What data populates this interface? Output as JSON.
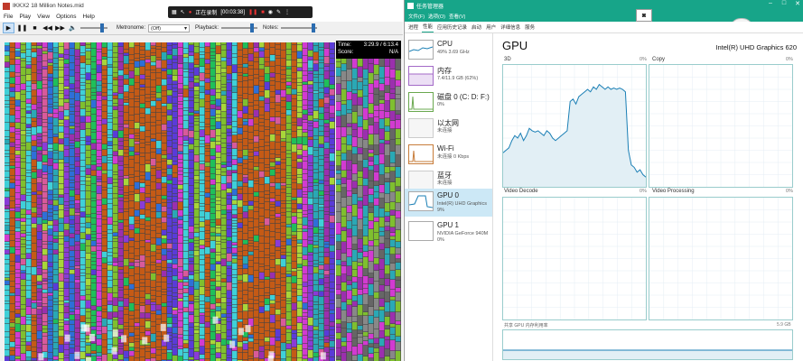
{
  "left_window": {
    "title": "IKKX2 18 Million Notes.mid",
    "menu": [
      "File",
      "Play",
      "View",
      "Options",
      "Help"
    ],
    "toolbar": {
      "metronome_label": "Metronome:",
      "metronome_value": "(Off)",
      "playback_label": "Playback:",
      "notes_label": "Notes:"
    },
    "recording_bar": {
      "status": "正在录制",
      "time": "[00:03:38]"
    },
    "info": {
      "time_label": "Time:",
      "time_value": "3:29.9 / 6:13.4",
      "score_label": "Score:",
      "score_value": "N/A"
    }
  },
  "task_manager": {
    "title": "任务管理器",
    "menu": [
      "文件(F)",
      "选项(O)",
      "查看(V)"
    ],
    "tabs": [
      "进程",
      "性能",
      "应用历史记录",
      "启动",
      "用户",
      "详细信息",
      "服务"
    ],
    "active_tab": "性能",
    "resources": [
      {
        "name": "CPU",
        "sub": "49% 3.69 GHz"
      },
      {
        "name": "内存",
        "sub": "7.4/11.9 GB (62%)"
      },
      {
        "name": "磁盘 0 (C: D: F:)",
        "sub": "0%"
      },
      {
        "name": "以太网",
        "sub": "未连接"
      },
      {
        "name": "Wi-Fi",
        "sub": "未连接 0 Kbps"
      },
      {
        "name": "蓝牙",
        "sub": "未连接"
      },
      {
        "name": "GPU 0",
        "sub": "Intel(R) UHD Graphics",
        "sub2": "9%"
      },
      {
        "name": "GPU 1",
        "sub": "NVIDIA GeForce 940M",
        "sub2": "0%"
      }
    ],
    "gpu_panel": {
      "title": "GPU",
      "device": "Intel(R) UHD Graphics 620",
      "graphs": [
        {
          "label": "3D",
          "pct": "0%"
        },
        {
          "label": "Copy",
          "pct": "0%"
        },
        {
          "label": "Video Decode",
          "pct": "0%"
        },
        {
          "label": "Video Processing",
          "pct": "0%"
        }
      ],
      "shared_memory_label": "共享 GPU 内存利用率",
      "shared_memory_value": "5.9 GB"
    },
    "colors": {
      "accent": "#17a589",
      "graph_line": "#1a7fb5",
      "graph_fill": "#e2eff5"
    }
  },
  "chart_data": {
    "type": "line",
    "title": "3D",
    "xlabel": "",
    "ylabel": "",
    "ylim": [
      0,
      100
    ],
    "series": [
      {
        "values": [
          28,
          30,
          32,
          38,
          42,
          40,
          44,
          38,
          42,
          48,
          46,
          45,
          46,
          44,
          42,
          46,
          44,
          40,
          38,
          40,
          42,
          44,
          46,
          70,
          72,
          68,
          74,
          76,
          78,
          80,
          78,
          82,
          80,
          84,
          82,
          80,
          82,
          80,
          81,
          80,
          81,
          80,
          78,
          30,
          18,
          16,
          12,
          14,
          10,
          8
        ]
      }
    ]
  }
}
